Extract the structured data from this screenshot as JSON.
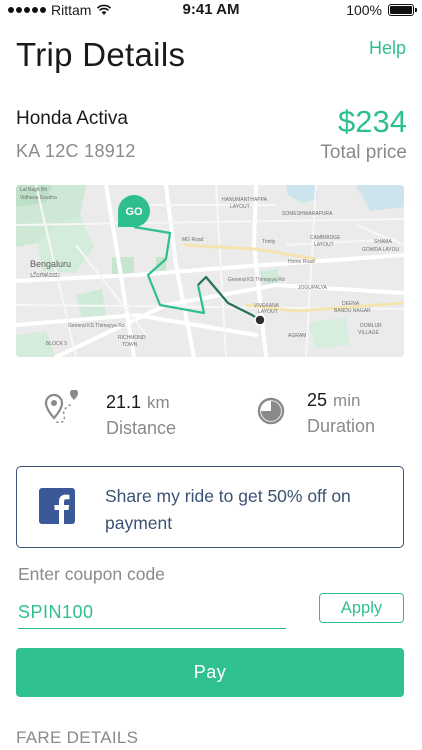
{
  "status_bar": {
    "carrier": "Rittam",
    "time": "9:41 AM",
    "battery": "100%",
    "icons": [
      "signal-dots-icon",
      "wifi-icon",
      "battery-icon"
    ]
  },
  "header": {
    "title": "Trip Details",
    "help_label": "Help"
  },
  "trip": {
    "vehicle_name": "Honda Activa",
    "plate": "KA 12C 18912",
    "price": "$234",
    "price_label": "Total price"
  },
  "map": {
    "marker_label": "GO",
    "labels": {
      "bengaluru": "Bengaluru",
      "bengaluru_kannada": "ಬೆಂಗಳೂರು",
      "hanumanthappa": "HANUMANTHAPPA",
      "hanumanthappa_2": "LAYOUT",
      "someshwarapura": "SOMESHWARAPURA",
      "cambridge": "CAMBRIDGE",
      "cambridge_2": "LAYOUT",
      "shama": "SHAMA",
      "gowda": "GOWDA LAYOU",
      "jogupalya": "JOGUPALYA",
      "richmond": "RICHMOND",
      "richmond_2": "TOWN",
      "block5": "BLOCK 5",
      "domlur": "DOMLUR",
      "domlur_2": "VILLAGE",
      "agram": "AGRAM",
      "deena": "DEENA",
      "deena_2": "BANDU NAGAR",
      "vivek": "VIVEKANA",
      "vivek_2": "LAYOUT",
      "trinity": "Trinity",
      "msroad": "MG Road",
      "homeroad": "Home Road",
      "general1": "General KS Thimayya Rd",
      "general2": "General KS Thimayya Rd"
    },
    "route_colors": {
      "traveled": "#2fbf8f",
      "remaining": "#26705a"
    }
  },
  "stats": {
    "distance": {
      "value": "21.1",
      "unit": "km",
      "label": "Distance",
      "icon": "map-pin-route-icon"
    },
    "duration": {
      "value": "25",
      "unit": "min",
      "label": "Duration",
      "icon": "pie-clock-icon"
    }
  },
  "share": {
    "text": "Share my ride to get 50% off on payment",
    "icon": "facebook-icon"
  },
  "coupon": {
    "label": "Enter coupon code",
    "value": "SPIN100",
    "apply_label": "Apply"
  },
  "pay_label": "Pay",
  "fare_heading": "FARE DETAILS",
  "colors": {
    "accent": "#2fbf8f",
    "facebook": "#3b5998",
    "share_border": "#3b5274"
  }
}
